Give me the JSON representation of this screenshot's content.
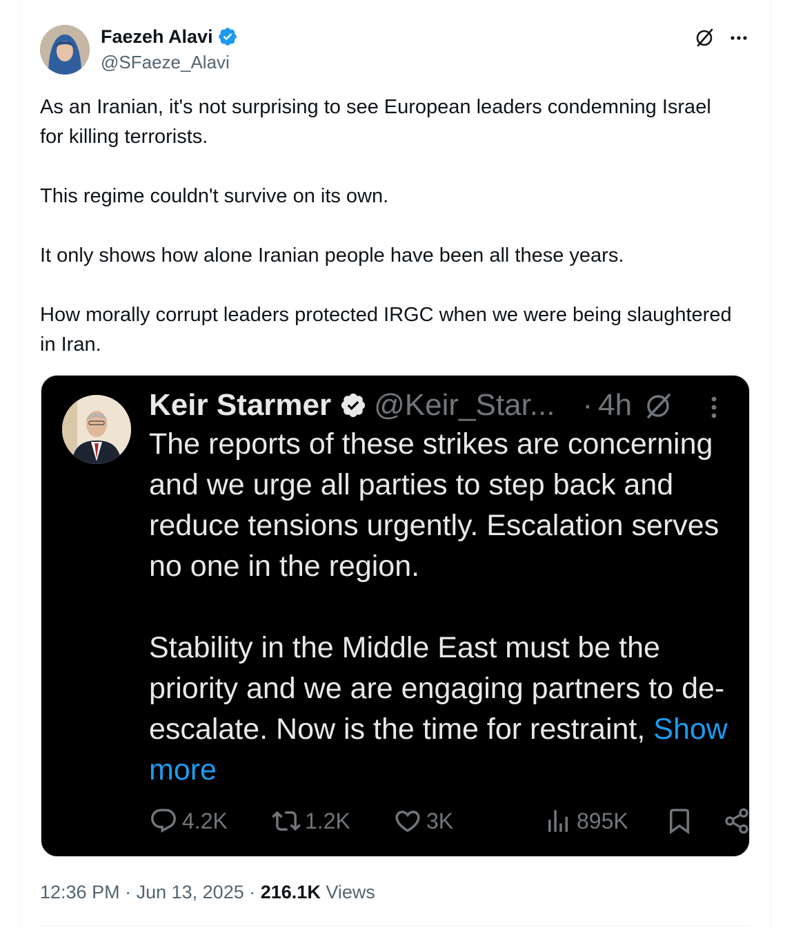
{
  "tweet": {
    "author": {
      "name": "Faezeh Alavi",
      "handle": "@SFaeze_Alavi"
    },
    "paragraphs": [
      "As an Iranian, it's not surprising to see European leaders condemning Israel for killing terrorists.",
      "This regime couldn't survive on its own.",
      "It only shows how alone Iranian people have been all these years.",
      "How morally corrupt leaders protected IRGC when we were being slaughtered in Iran."
    ],
    "time": "12:36 PM",
    "date": "Jun 13, 2025",
    "views_count": "216.1K",
    "views_label": "Views"
  },
  "quoted": {
    "author": {
      "name": "Keir Starmer",
      "handle": "@Keir_Star...",
      "age": "4h"
    },
    "text": "The reports of these strikes are concerning and we urge all parties to step back and reduce tensions urgently. Escalation serves no one in the region.\n\nStability in the Middle East must be the priority and we are engaging partners to de-escalate. Now is the time for restraint, ",
    "show_more": "Show more",
    "stats": {
      "replies": "4.2K",
      "reposts": "1.2K",
      "likes": "3K",
      "views": "895K"
    }
  },
  "colors": {
    "accent": "#1d9bf0",
    "verified": "#1d9bf0",
    "text_primary": "#0f1419",
    "text_secondary": "#536471",
    "quote_bg": "#000000",
    "quote_text": "#e7e9ea",
    "quote_muted": "#71767b"
  },
  "icons": [
    "verified-badge-icon",
    "grok-icon",
    "more-icon",
    "reply-icon",
    "repost-icon",
    "like-icon",
    "views-icon",
    "bookmark-icon",
    "share-icon"
  ]
}
